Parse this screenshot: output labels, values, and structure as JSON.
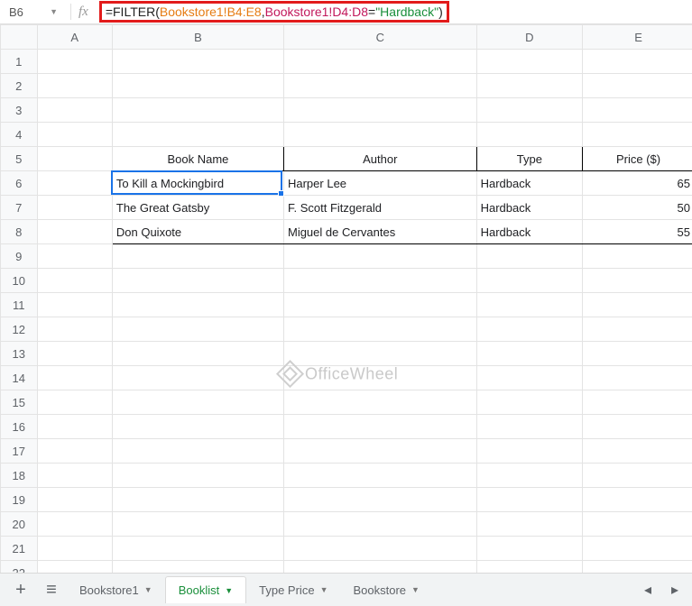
{
  "name_box": "B6",
  "formula": {
    "parts": [
      {
        "t": "=FILTER(",
        "cls": "tok-plain"
      },
      {
        "t": "Bookstore1!B4:E8",
        "cls": "tok-range1"
      },
      {
        "t": ",",
        "cls": "tok-plain"
      },
      {
        "t": "Bookstore1!D4:D8",
        "cls": "tok-range2"
      },
      {
        "t": "=",
        "cls": "tok-plain"
      },
      {
        "t": "\"Hardback\"",
        "cls": "tok-string"
      },
      {
        "t": ")",
        "cls": "tok-plain"
      }
    ]
  },
  "columns": [
    "A",
    "B",
    "C",
    "D",
    "E"
  ],
  "row_count": 23,
  "headers": {
    "b5": "Book Name",
    "c5": "Author",
    "d5": "Type",
    "e5": "Price ($)"
  },
  "rows": [
    {
      "b": "To Kill a Mockingbird",
      "c": "Harper Lee",
      "d": "Hardback",
      "e": "65"
    },
    {
      "b": "The Great Gatsby",
      "c": "F. Scott Fitzgerald",
      "d": "Hardback",
      "e": "50"
    },
    {
      "b": "Don Quixote",
      "c": "Miguel de Cervantes",
      "d": "Hardback",
      "e": "55"
    }
  ],
  "tabs": {
    "items": [
      {
        "label": "Bookstore1",
        "active": false
      },
      {
        "label": "Booklist",
        "active": true
      },
      {
        "label": "Type Price",
        "active": false
      },
      {
        "label": "Bookstore",
        "active": false
      }
    ]
  },
  "watermark": "OfficeWheel",
  "chart_data": {
    "type": "table",
    "title": "",
    "columns": [
      "Book Name",
      "Author",
      "Type",
      "Price ($)"
    ],
    "rows": [
      [
        "To Kill a Mockingbird",
        "Harper Lee",
        "Hardback",
        65
      ],
      [
        "The Great Gatsby",
        "F. Scott Fitzgerald",
        "Hardback",
        50
      ],
      [
        "Don Quixote",
        "Miguel de Cervantes",
        "Hardback",
        55
      ]
    ]
  }
}
